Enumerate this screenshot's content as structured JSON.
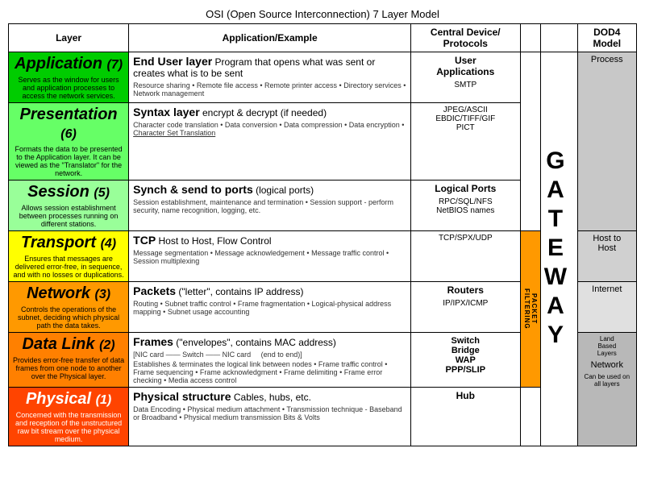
{
  "title": "OSI (Open Source Interconnection) 7 Layer Model",
  "headers": {
    "layer": "Layer",
    "application": "Application/Example",
    "central": "Central Device/ Protocols",
    "dod4": "DOD4 Model"
  },
  "layers": [
    {
      "id": "application",
      "name": "Application",
      "number": "(7)",
      "color": "#00cc00",
      "desc": "Serves as the window for users and application processes to access the network services.",
      "main_bold": "End User layer",
      "main_text": " Program that opens what was sent or creates what is to be sent",
      "detail": "Resource sharing • Remote file access • Remote printer access • Directory services • Network management",
      "central_name": "User Applications",
      "central_protocol": "SMTP",
      "dod": "Process",
      "dod_class": "dod-process"
    },
    {
      "id": "presentation",
      "name": "Presentation",
      "number": "(6)",
      "color": "#66ff66",
      "desc": "Formats the data to be presented to the Application layer. It can be viewed as the \"Translator\" for the network.",
      "main_bold": "Syntax layer",
      "main_text": " encrypt & decrypt (if needed)",
      "detail": "Character code translation • Data conversion • Data compression • Data encryption • Character Set Translation",
      "central_name": "JPEG/ASCII EBDIC/TIFF/GIF PICT",
      "central_protocol": "",
      "dod": "Process",
      "dod_class": "dod-process"
    },
    {
      "id": "session",
      "name": "Session",
      "number": "(5)",
      "color": "#99ff99",
      "desc": "Allows session establishment between processes running on different stations.",
      "main_bold": "Synch & send to ports",
      "main_text": " (logical ports)",
      "detail": "Session establishment, maintenance and termination • Session support - perform security, name recognition, logging, etc.",
      "central_name": "Logical Ports",
      "central_protocol": "RPC/SQL/NFS NetBIOS names",
      "dod": "",
      "dod_class": ""
    },
    {
      "id": "transport",
      "name": "Transport",
      "number": "(4)",
      "color": "#ffff00",
      "desc": "Ensures that messages are delivered error-free, in sequence, and with no losses or duplications.",
      "main_bold": "TCP",
      "main_text": "  Host to Host, Flow Control",
      "detail": "Message segmentation • Message acknowledgement • Message traffic control • Session multiplexing",
      "central_name": "",
      "central_protocol": "TCP/SPX/UDP",
      "dod": "Host to Host",
      "dod_class": "dod-host"
    },
    {
      "id": "network",
      "name": "Network",
      "number": "(3)",
      "color": "#ff9900",
      "desc": "Controls the operations of the subnet, deciding which physical path the data takes.",
      "main_bold": "Packets",
      "main_text": " (\"letter\", contains IP address)",
      "detail": "Routing • Subnet traffic control • Frame fragmentation • Logical-physical address mapping • Subnet usage accounting",
      "central_name": "Routers",
      "central_protocol": "IP/IPX/ICMP",
      "dod": "Internet",
      "dod_class": "dod-internet"
    },
    {
      "id": "datalink",
      "name": "Data Link",
      "number": "(2)",
      "color": "#ff8000",
      "desc": "Provides error-free transfer of data frames from one node to another over the Physical layer.",
      "main_bold": "Frames",
      "main_text": " (\"envelopes\", contains MAC address)",
      "detail_line1": "[NIC card —— Switch —— NIC card          (end to end)]",
      "detail": "Establishes & terminates the logical link between nodes • Frame traffic control • Frame sequencing • Frame acknowledgment • Frame delimiting • Frame error checking • Media access control",
      "central_name": "Switch Bridge WAP PPP/SLIP",
      "central_protocol": "",
      "dod": "Network",
      "dod_class": "dod-network",
      "land_label": "Land Based Layers"
    },
    {
      "id": "physical",
      "name": "Physical",
      "number": "(1)",
      "color": "#ff4400",
      "desc": "Concerned with the transmission and reception of the unstructured raw bit stream over the physical medium.",
      "main_bold": "Physical structure",
      "main_text": " Cables, hubs, etc.",
      "detail": "Data Encoding • Physical medium attachment • Transmission technique - Baseband or Broadband • Physical medium transmission Bits & Volts",
      "central_name": "Hub",
      "central_protocol": "",
      "dod": "Network",
      "dod_class": "dod-network"
    }
  ],
  "packet_filtering": "PACKET FILTERING",
  "gateway_label": "GATEWAY",
  "can_be_used": "Can be used on all layers"
}
